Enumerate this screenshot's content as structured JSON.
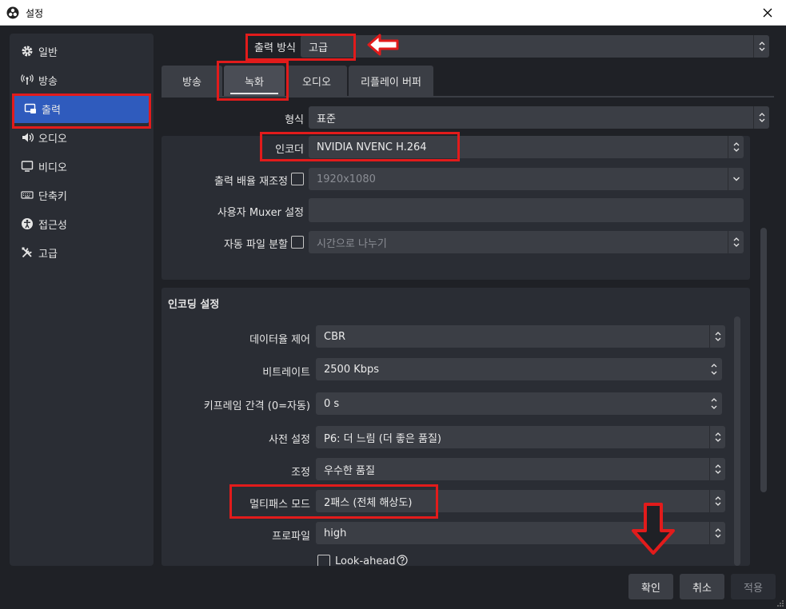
{
  "window": {
    "title": "설정"
  },
  "sidebar": {
    "items": [
      {
        "label": "일반",
        "icon": "gear-icon"
      },
      {
        "label": "방송",
        "icon": "broadcast-antenna-icon"
      },
      {
        "label": "출력",
        "icon": "output-monitor-icon"
      },
      {
        "label": "오디오",
        "icon": "speaker-icon"
      },
      {
        "label": "비디오",
        "icon": "monitor-icon"
      },
      {
        "label": "단축키",
        "icon": "keyboard-icon"
      },
      {
        "label": "접근성",
        "icon": "accessibility-icon"
      },
      {
        "label": "고급",
        "icon": "tools-icon"
      }
    ],
    "active_index": 2
  },
  "output_mode": {
    "label": "출력 방식",
    "value": "고급"
  },
  "tabs": {
    "items": [
      "방송",
      "녹화",
      "오디오",
      "리플레이 버퍼"
    ],
    "active_index": 1
  },
  "recording": {
    "format": {
      "label": "형식",
      "value": "표준"
    },
    "encoder": {
      "label": "인코더",
      "value": "NVIDIA NVENC H.264"
    },
    "rescale": {
      "label": "출력 배율 재조정",
      "value": "1920x1080",
      "checked": false
    },
    "muxer": {
      "label": "사용자 Muxer 설정",
      "value": ""
    },
    "split": {
      "label": "자동 파일 분할",
      "value": "시간으로 나누기",
      "checked": false
    }
  },
  "encoding": {
    "title": "인코딩 설정",
    "rate_control": {
      "label": "데이터율 제어",
      "value": "CBR"
    },
    "bitrate": {
      "label": "비트레이트",
      "value": "2500 Kbps"
    },
    "keyframe": {
      "label": "키프레임 간격 (0=자동)",
      "value": "0 s"
    },
    "preset": {
      "label": "사전 설정",
      "value": "P6: 더 느림 (더 좋은 품질)"
    },
    "tuning": {
      "label": "조정",
      "value": "우수한 품질"
    },
    "multipass": {
      "label": "멀티패스 모드",
      "value": "2패스 (전체 해상도)"
    },
    "profile": {
      "label": "프로파일",
      "value": "high"
    },
    "lookahead": {
      "label": "Look-ahead",
      "checked": false
    }
  },
  "buttons": {
    "ok": "확인",
    "cancel": "취소",
    "apply": "적용"
  },
  "colors": {
    "highlight": "#e21b1b",
    "accent": "#2f5bbd"
  }
}
